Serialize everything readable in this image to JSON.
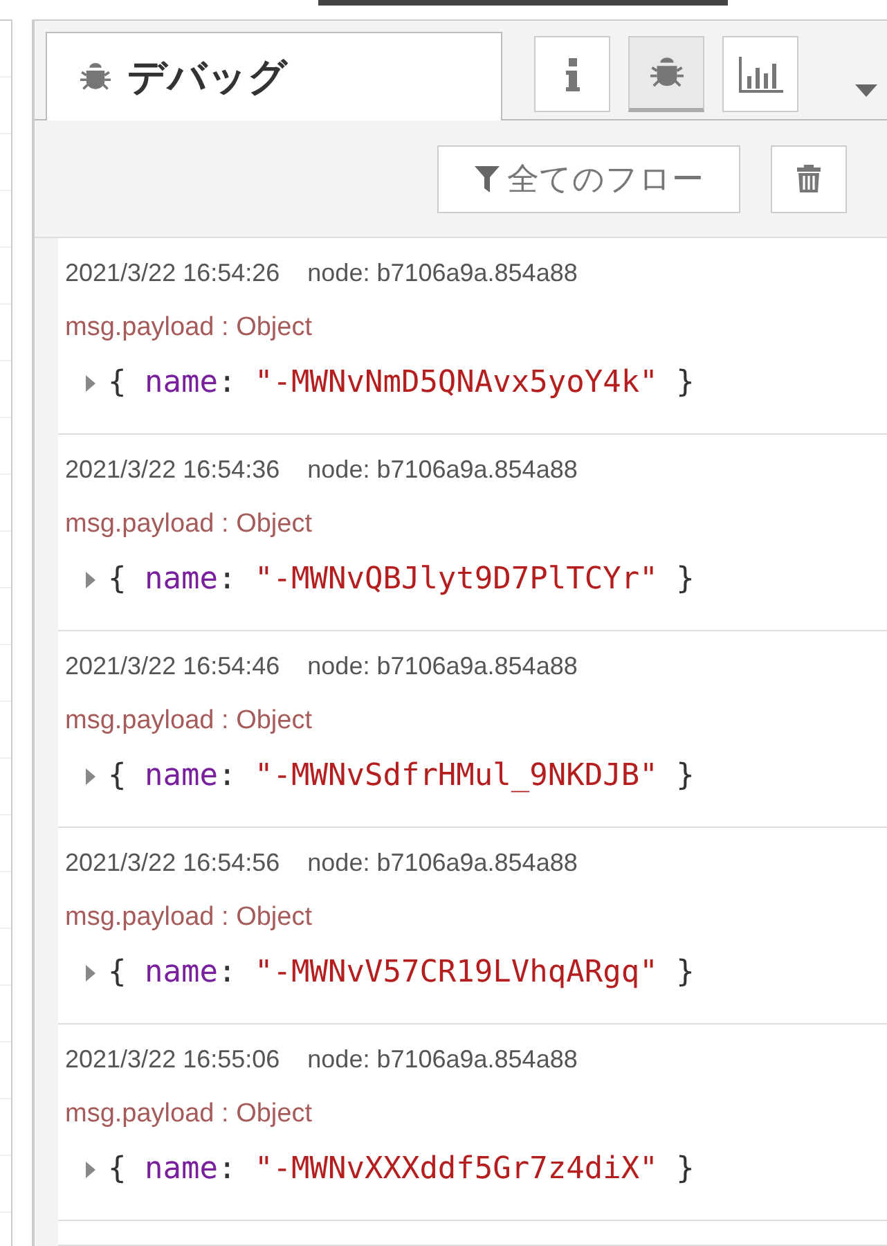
{
  "sidebar": {
    "tab": {
      "label": "デバッグ",
      "selected": true
    },
    "view_buttons": [
      {
        "kind": "info",
        "selected": false
      },
      {
        "kind": "debug",
        "selected": true
      },
      {
        "kind": "chart",
        "selected": false
      }
    ],
    "filter_button": {
      "label": "全てのフロー"
    },
    "messages": [
      {
        "time": "2021/3/22 16:54:26",
        "node": "node: b7106a9a.854a88",
        "topic": "msg.payload : Object",
        "open": "{",
        "key": "name",
        "separator": ":",
        "value": "\"-MWNvNmD5QNAvx5yoY4k\"",
        "close": "}",
        "expanded": false
      },
      {
        "time": "2021/3/22 16:54:36",
        "node": "node: b7106a9a.854a88",
        "topic": "msg.payload : Object",
        "open": "{",
        "key": "name",
        "separator": ":",
        "value": "\"-MWNvQBJlyt9D7PlTCYr\"",
        "close": "}",
        "expanded": false
      },
      {
        "time": "2021/3/22 16:54:46",
        "node": "node: b7106a9a.854a88",
        "topic": "msg.payload : Object",
        "open": "{",
        "key": "name",
        "separator": ":",
        "value": "\"-MWNvSdfrHMul_9NKDJB\"",
        "close": "}",
        "expanded": false
      },
      {
        "time": "2021/3/22 16:54:56",
        "node": "node: b7106a9a.854a88",
        "topic": "msg.payload : Object",
        "open": "{",
        "key": "name",
        "separator": ":",
        "value": "\"-MWNvV57CR19LVhqARgq\"",
        "close": "}",
        "expanded": false
      },
      {
        "time": "2021/3/22 16:55:06",
        "node": "node: b7106a9a.854a88",
        "topic": "msg.payload : Object",
        "open": "{",
        "key": "name",
        "separator": ":",
        "value": "\"-MWNvXXXddf5Gr7z4diX\"",
        "close": "}",
        "expanded": false
      }
    ]
  }
}
